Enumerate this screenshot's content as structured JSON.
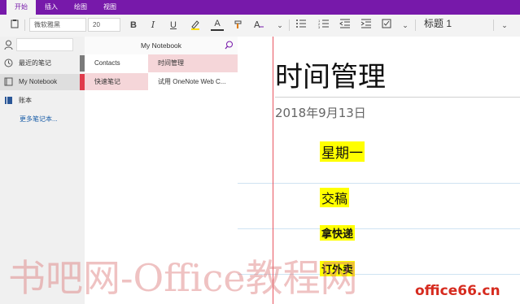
{
  "ribbon": {
    "tabs": [
      "开始",
      "插入",
      "绘图",
      "视图"
    ],
    "active_tab": "开始"
  },
  "toolbar": {
    "font_family": "微软雅黑",
    "font_size": "20",
    "bold": "B",
    "italic": "I",
    "underline": "U",
    "font_color": "A",
    "style": "标题 1"
  },
  "nav": {
    "items": [
      {
        "label": "最近的笔记",
        "icon": "clock-icon"
      },
      {
        "label": "My Notebook",
        "icon": "notebook-icon",
        "accent": "#7a7a7a"
      },
      {
        "label": "账本",
        "icon": "notebook-blue-icon",
        "accent": "#2b5797"
      }
    ],
    "more_link": "更多笔记本..."
  },
  "notebook": {
    "title": "My Notebook"
  },
  "sections": [
    {
      "label": "Contacts",
      "accent": "#7a7a7a"
    },
    {
      "label": "快速笔记",
      "accent": "#e03a4a"
    }
  ],
  "pages": [
    {
      "label": "时间管理"
    },
    {
      "label": "试用 OneNote Web C..."
    }
  ],
  "page": {
    "title": "时间管理",
    "date": "2018年9月13日",
    "notes": [
      "星期一",
      "交稿",
      "拿快递",
      "订外卖"
    ]
  },
  "watermark": {
    "text": "书吧网-Office教程网",
    "site": "office66.cn"
  },
  "colors": {
    "brand": "#7719aa",
    "section_accent": "#e03a4a",
    "highlight": "#ffff00"
  }
}
